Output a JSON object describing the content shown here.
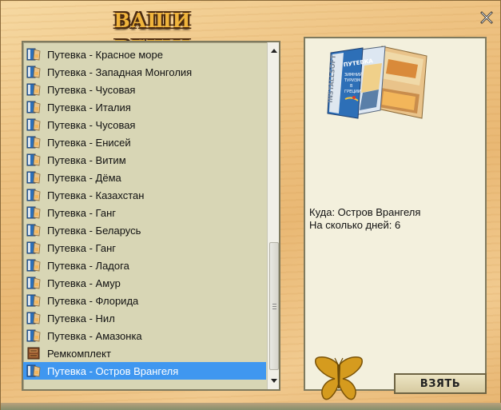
{
  "window": {
    "title": "ВАШИ ВЕЩИ",
    "close_icon": "close-x-icon"
  },
  "list": {
    "items": [
      {
        "label": "Путевка - Красное море",
        "icon": "voucher-icon"
      },
      {
        "label": "Путевка - Западная Монголия",
        "icon": "voucher-icon"
      },
      {
        "label": "Путевка - Чусовая",
        "icon": "voucher-icon"
      },
      {
        "label": "Путевка - Италия",
        "icon": "voucher-icon"
      },
      {
        "label": "Путевка - Чусовая",
        "icon": "voucher-icon"
      },
      {
        "label": "Путевка - Енисей",
        "icon": "voucher-icon"
      },
      {
        "label": "Путевка - Витим",
        "icon": "voucher-icon"
      },
      {
        "label": "Путевка - Дёма",
        "icon": "voucher-icon"
      },
      {
        "label": "Путевка - Казахстан",
        "icon": "voucher-icon"
      },
      {
        "label": "Путевка - Ганг",
        "icon": "voucher-icon"
      },
      {
        "label": "Путевка - Беларусь",
        "icon": "voucher-icon"
      },
      {
        "label": "Путевка - Ганг",
        "icon": "voucher-icon"
      },
      {
        "label": "Путевка - Ладога",
        "icon": "voucher-icon"
      },
      {
        "label": "Путевка - Амур",
        "icon": "voucher-icon"
      },
      {
        "label": "Путевка - Флорида",
        "icon": "voucher-icon"
      },
      {
        "label": "Путевка - Нил",
        "icon": "voucher-icon"
      },
      {
        "label": "Путевка - Амазонка",
        "icon": "voucher-icon"
      },
      {
        "label": "Ремкомплект",
        "icon": "repair-kit-icon"
      },
      {
        "label": "Путевка - Остров Врангеля",
        "icon": "voucher-icon",
        "selected": true
      }
    ]
  },
  "detail": {
    "image": "travel-brochure-icon",
    "brochure_brand": "INSTALLSOFT",
    "brochure_label": "ПУТЕВКА",
    "brochure_text": [
      "ЗИМНИЙ",
      "ТУРИЗМ",
      "В",
      "ГРЕЦИИ"
    ],
    "destination_line": "Куда: Остров Врангеля",
    "days_line": "На сколько дней: 6"
  },
  "footer": {
    "butterfly_icon": "butterfly-icon",
    "take_button": "ВЗЯТЬ"
  },
  "colors": {
    "selection": "#3f97f0",
    "title": "#f0b43c",
    "panel": "#d8d6b5",
    "detail_bg": "#f3f0dd"
  }
}
